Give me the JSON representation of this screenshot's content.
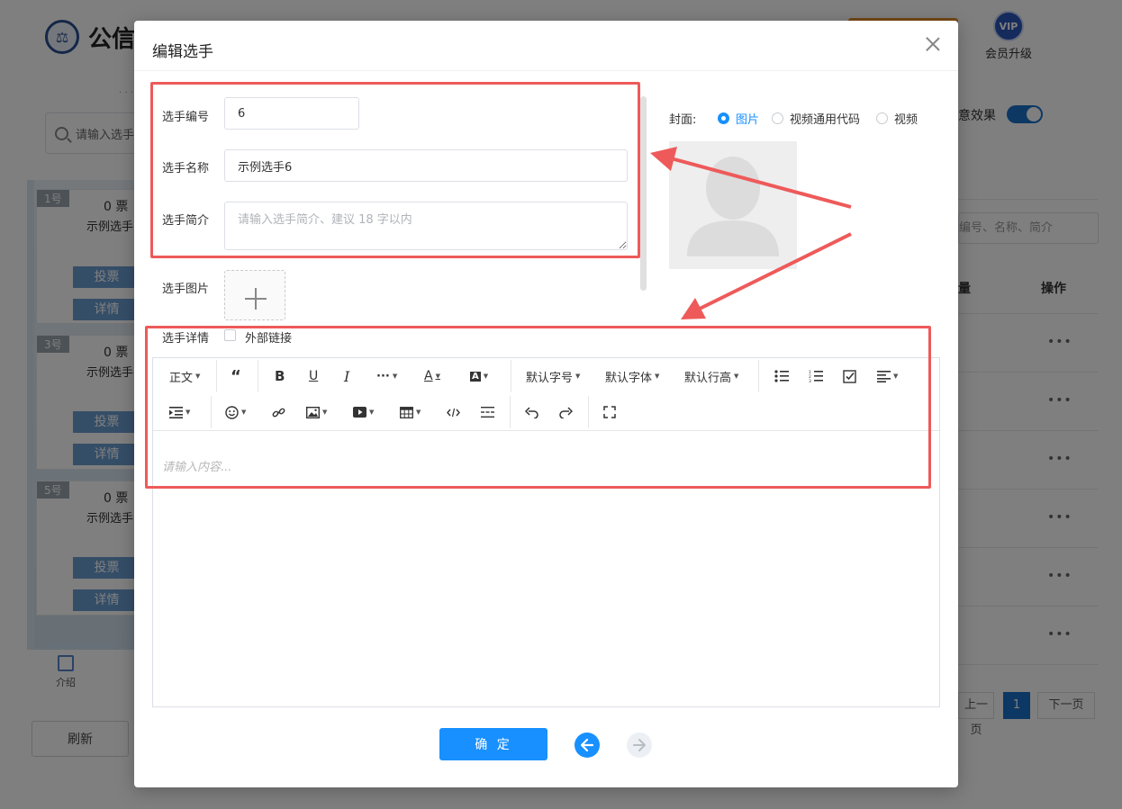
{
  "background": {
    "app_name": "公信",
    "vip_badge": "VIP",
    "vip_label": "会员升级",
    "dots": "· · ·",
    "search_placeholder": "请输入选手",
    "cards": [
      {
        "tag": "1号",
        "votes": "0 票",
        "name": "示例选手",
        "vote": "投票",
        "detail": "详情"
      },
      {
        "tag": "3号",
        "votes": "0 票",
        "name": "示例选手",
        "vote": "投票",
        "detail": "详情"
      },
      {
        "tag": "5号",
        "votes": "0 票",
        "name": "示例选手",
        "vote": "投票",
        "detail": "详情"
      }
    ],
    "intro_label": "介绍",
    "refresh": "刷新",
    "effect_label": "意效果",
    "filter_placeholder": "编号、名称、简介",
    "col_quantity": "量",
    "col_action": "操作",
    "row_actions": [
      "•••",
      "•••",
      "•••",
      "•••",
      "•••",
      "•••"
    ],
    "prev_page": "上一页",
    "page": "1",
    "next_page": "下一页"
  },
  "modal": {
    "title": "编辑选手",
    "fields": {
      "number_label": "选手编号",
      "number_value": "6",
      "name_label": "选手名称",
      "name_value": "示例选手6",
      "intro_label": "选手简介",
      "intro_placeholder": "请输入选手简介、建议 18 字以内",
      "image_label": "选手图片",
      "detail_label": "选手详情",
      "external_link_label": "外部链接"
    },
    "cover": {
      "label": "封面:",
      "options": [
        "图片",
        "视频通用代码",
        "视频"
      ],
      "selected": "图片"
    },
    "editor": {
      "toolbar_row1": [
        "正文",
        "“",
        "B",
        "U",
        "I",
        "···",
        "A",
        "A",
        "默认字号",
        "默认字体",
        "默认行高"
      ],
      "placeholder": "请输入内容..."
    },
    "confirm_button": "确 定"
  },
  "colors": {
    "primary": "#1890ff",
    "annotation": "#ee5a5a"
  }
}
